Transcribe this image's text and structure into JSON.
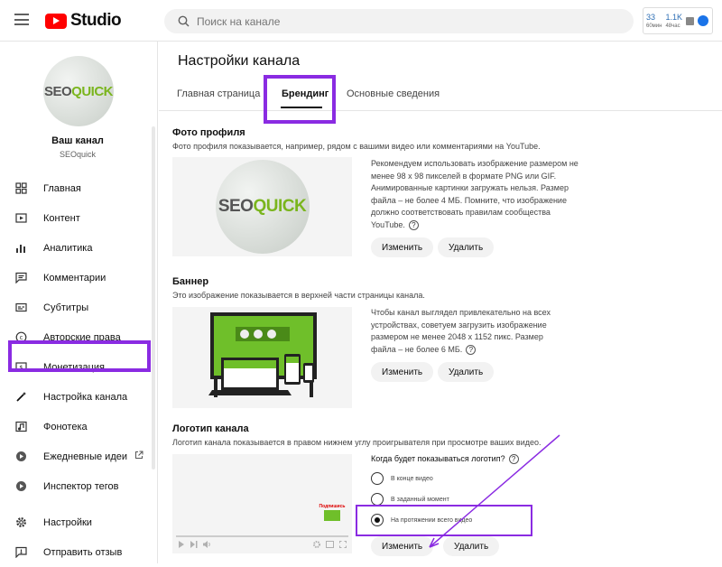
{
  "header": {
    "logo_text": "Studio",
    "search_placeholder": "Поиск на канале",
    "stats": [
      {
        "value": "33",
        "label": "60мин"
      },
      {
        "value": "1.1K",
        "label": "48час"
      }
    ]
  },
  "channel": {
    "name": "Ваш канал",
    "handle": "SEOquick",
    "logo_part1": "SEO",
    "logo_part2": "QUICK"
  },
  "sidebar": {
    "items": [
      {
        "label": "Главная",
        "icon": "dashboard-icon"
      },
      {
        "label": "Контент",
        "icon": "content-icon"
      },
      {
        "label": "Аналитика",
        "icon": "analytics-icon"
      },
      {
        "label": "Комментарии",
        "icon": "comments-icon"
      },
      {
        "label": "Субтитры",
        "icon": "subtitles-icon"
      },
      {
        "label": "Авторские права",
        "icon": "copyright-icon"
      },
      {
        "label": "Монетизация",
        "icon": "monetization-icon"
      },
      {
        "label": "Настройка канала",
        "icon": "customization-icon"
      },
      {
        "label": "Фонотека",
        "icon": "audio-library-icon"
      },
      {
        "label": "Ежедневные идеи",
        "icon": "ideas-icon"
      },
      {
        "label": "Инспектор тегов",
        "icon": "tag-inspector-icon"
      }
    ],
    "bottom": [
      {
        "label": "Настройки",
        "icon": "gear-icon"
      },
      {
        "label": "Отправить отзыв",
        "icon": "feedback-icon"
      }
    ]
  },
  "main": {
    "title": "Настройки канала",
    "tabs": [
      "Главная страница",
      "Брендинг",
      "Основные сведения"
    ],
    "profile": {
      "title": "Фото профиля",
      "desc": "Фото профиля показывается, например, рядом с вашими видео или комментариями на YouTube.",
      "info": "Рекомендуем использовать изображение размером не менее 98 x 98 пикселей в формате PNG или GIF. Анимированные картинки загружать нельзя. Размер файла – не более 4 МБ. Помните, что изображение должно соответствовать правилам сообщества YouTube.",
      "change": "Изменить",
      "delete": "Удалить"
    },
    "banner": {
      "title": "Баннер",
      "desc": "Это изображение показывается в верхней части страницы канала.",
      "info": "Чтобы канал выглядел привлекательно на всех устройствах, советуем загрузить изображение размером не менее 2048 x 1152 пикс. Размер файла – не более 6 МБ.",
      "change": "Изменить",
      "delete": "Удалить"
    },
    "watermark": {
      "title": "Логотип канала",
      "desc": "Логотип канала показывается в правом нижнем углу проигрывателя при просмотре ваших видео.",
      "question": "Когда будет показываться логотип?",
      "options": [
        "В конце видео",
        "В заданный момент",
        "На протяжении всего видео"
      ],
      "selected_index": 2,
      "sub_label": "Подпишись",
      "change": "Изменить",
      "delete": "Удалить"
    }
  },
  "colors": {
    "highlight": "#8a2be2",
    "brand_red": "#ff0000",
    "seo_green": "#7ab51d"
  }
}
